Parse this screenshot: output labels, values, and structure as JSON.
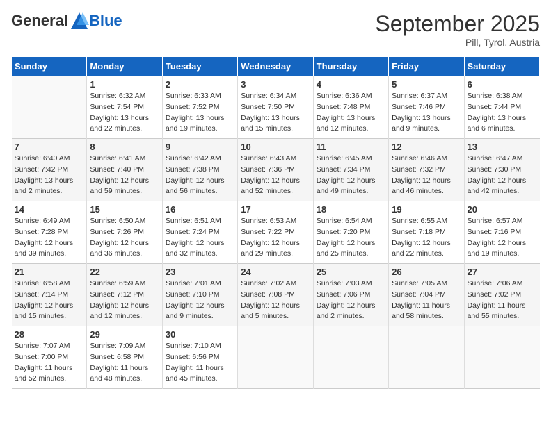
{
  "logo": {
    "general": "General",
    "blue": "Blue"
  },
  "title": "September 2025",
  "location": "Pill, Tyrol, Austria",
  "days_header": [
    "Sunday",
    "Monday",
    "Tuesday",
    "Wednesday",
    "Thursday",
    "Friday",
    "Saturday"
  ],
  "weeks": [
    [
      {
        "day": "",
        "info": ""
      },
      {
        "day": "1",
        "info": "Sunrise: 6:32 AM\nSunset: 7:54 PM\nDaylight: 13 hours\nand 22 minutes."
      },
      {
        "day": "2",
        "info": "Sunrise: 6:33 AM\nSunset: 7:52 PM\nDaylight: 13 hours\nand 19 minutes."
      },
      {
        "day": "3",
        "info": "Sunrise: 6:34 AM\nSunset: 7:50 PM\nDaylight: 13 hours\nand 15 minutes."
      },
      {
        "day": "4",
        "info": "Sunrise: 6:36 AM\nSunset: 7:48 PM\nDaylight: 13 hours\nand 12 minutes."
      },
      {
        "day": "5",
        "info": "Sunrise: 6:37 AM\nSunset: 7:46 PM\nDaylight: 13 hours\nand 9 minutes."
      },
      {
        "day": "6",
        "info": "Sunrise: 6:38 AM\nSunset: 7:44 PM\nDaylight: 13 hours\nand 6 minutes."
      }
    ],
    [
      {
        "day": "7",
        "info": "Sunrise: 6:40 AM\nSunset: 7:42 PM\nDaylight: 13 hours\nand 2 minutes."
      },
      {
        "day": "8",
        "info": "Sunrise: 6:41 AM\nSunset: 7:40 PM\nDaylight: 12 hours\nand 59 minutes."
      },
      {
        "day": "9",
        "info": "Sunrise: 6:42 AM\nSunset: 7:38 PM\nDaylight: 12 hours\nand 56 minutes."
      },
      {
        "day": "10",
        "info": "Sunrise: 6:43 AM\nSunset: 7:36 PM\nDaylight: 12 hours\nand 52 minutes."
      },
      {
        "day": "11",
        "info": "Sunrise: 6:45 AM\nSunset: 7:34 PM\nDaylight: 12 hours\nand 49 minutes."
      },
      {
        "day": "12",
        "info": "Sunrise: 6:46 AM\nSunset: 7:32 PM\nDaylight: 12 hours\nand 46 minutes."
      },
      {
        "day": "13",
        "info": "Sunrise: 6:47 AM\nSunset: 7:30 PM\nDaylight: 12 hours\nand 42 minutes."
      }
    ],
    [
      {
        "day": "14",
        "info": "Sunrise: 6:49 AM\nSunset: 7:28 PM\nDaylight: 12 hours\nand 39 minutes."
      },
      {
        "day": "15",
        "info": "Sunrise: 6:50 AM\nSunset: 7:26 PM\nDaylight: 12 hours\nand 36 minutes."
      },
      {
        "day": "16",
        "info": "Sunrise: 6:51 AM\nSunset: 7:24 PM\nDaylight: 12 hours\nand 32 minutes."
      },
      {
        "day": "17",
        "info": "Sunrise: 6:53 AM\nSunset: 7:22 PM\nDaylight: 12 hours\nand 29 minutes."
      },
      {
        "day": "18",
        "info": "Sunrise: 6:54 AM\nSunset: 7:20 PM\nDaylight: 12 hours\nand 25 minutes."
      },
      {
        "day": "19",
        "info": "Sunrise: 6:55 AM\nSunset: 7:18 PM\nDaylight: 12 hours\nand 22 minutes."
      },
      {
        "day": "20",
        "info": "Sunrise: 6:57 AM\nSunset: 7:16 PM\nDaylight: 12 hours\nand 19 minutes."
      }
    ],
    [
      {
        "day": "21",
        "info": "Sunrise: 6:58 AM\nSunset: 7:14 PM\nDaylight: 12 hours\nand 15 minutes."
      },
      {
        "day": "22",
        "info": "Sunrise: 6:59 AM\nSunset: 7:12 PM\nDaylight: 12 hours\nand 12 minutes."
      },
      {
        "day": "23",
        "info": "Sunrise: 7:01 AM\nSunset: 7:10 PM\nDaylight: 12 hours\nand 9 minutes."
      },
      {
        "day": "24",
        "info": "Sunrise: 7:02 AM\nSunset: 7:08 PM\nDaylight: 12 hours\nand 5 minutes."
      },
      {
        "day": "25",
        "info": "Sunrise: 7:03 AM\nSunset: 7:06 PM\nDaylight: 12 hours\nand 2 minutes."
      },
      {
        "day": "26",
        "info": "Sunrise: 7:05 AM\nSunset: 7:04 PM\nDaylight: 11 hours\nand 58 minutes."
      },
      {
        "day": "27",
        "info": "Sunrise: 7:06 AM\nSunset: 7:02 PM\nDaylight: 11 hours\nand 55 minutes."
      }
    ],
    [
      {
        "day": "28",
        "info": "Sunrise: 7:07 AM\nSunset: 7:00 PM\nDaylight: 11 hours\nand 52 minutes."
      },
      {
        "day": "29",
        "info": "Sunrise: 7:09 AM\nSunset: 6:58 PM\nDaylight: 11 hours\nand 48 minutes."
      },
      {
        "day": "30",
        "info": "Sunrise: 7:10 AM\nSunset: 6:56 PM\nDaylight: 11 hours\nand 45 minutes."
      },
      {
        "day": "",
        "info": ""
      },
      {
        "day": "",
        "info": ""
      },
      {
        "day": "",
        "info": ""
      },
      {
        "day": "",
        "info": ""
      }
    ]
  ]
}
